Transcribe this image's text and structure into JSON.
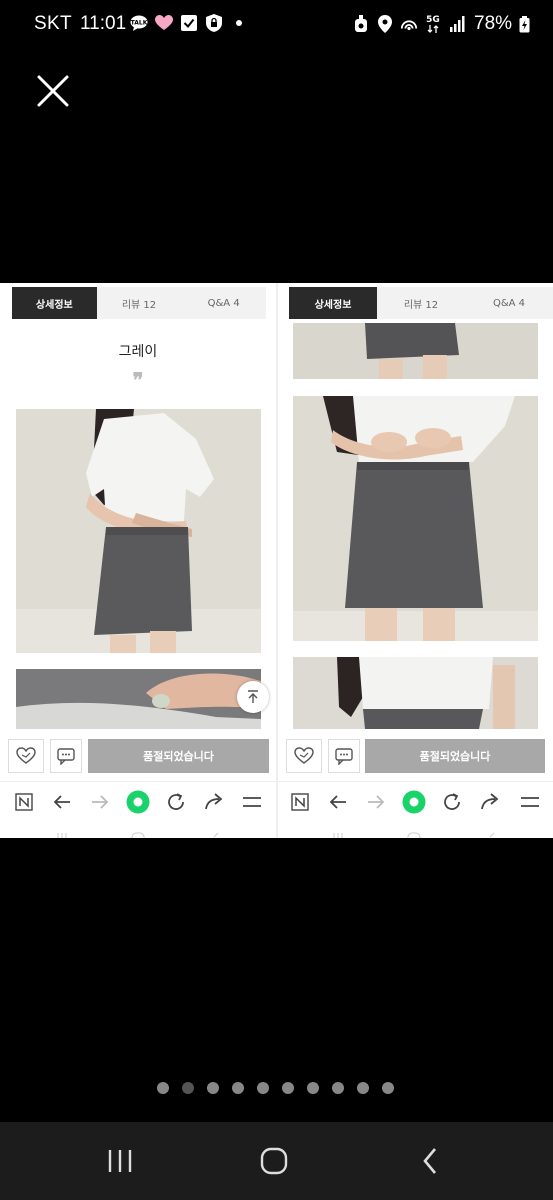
{
  "status_bar": {
    "carrier": "SKT",
    "time": "11:01",
    "battery": "78%",
    "network": "5G",
    "left_icons": [
      "talk-icon",
      "heart-icon",
      "checkbox-icon",
      "shield-icon",
      "dot-icon"
    ],
    "right_icons": [
      "alarm-icon",
      "location-icon",
      "hotspot-icon",
      "network-5g-icon",
      "signal-icon",
      "battery-icon"
    ]
  },
  "viewer": {
    "close_icon": "close-icon",
    "page_count": 10,
    "active_page": 2
  },
  "left_screen": {
    "tabs": [
      {
        "label": "상세정보"
      },
      {
        "label": "리뷰 12"
      },
      {
        "label": "Q&A 4"
      }
    ],
    "caption": "그레이",
    "quote_mark": "❞",
    "sold_out_label": "품절되었습니다"
  },
  "right_screen": {
    "tabs": [
      {
        "label": "상세정보"
      },
      {
        "label": "리뷰 12"
      },
      {
        "label": "Q&A 4"
      }
    ],
    "sold_out_label": "품절되었습니다"
  },
  "browser_nav": {
    "items": [
      "naver-icon",
      "back-arrow-icon",
      "forward-arrow-icon",
      "green-dot-icon",
      "refresh-icon",
      "share-icon",
      "menu-icon"
    ]
  },
  "colors": {
    "background": "#000000",
    "tab_active": "#2a2a2a",
    "sold_out_button": "#a8a8a8",
    "green_accent": "#19d36a",
    "skirt": "#5a5a5c"
  }
}
